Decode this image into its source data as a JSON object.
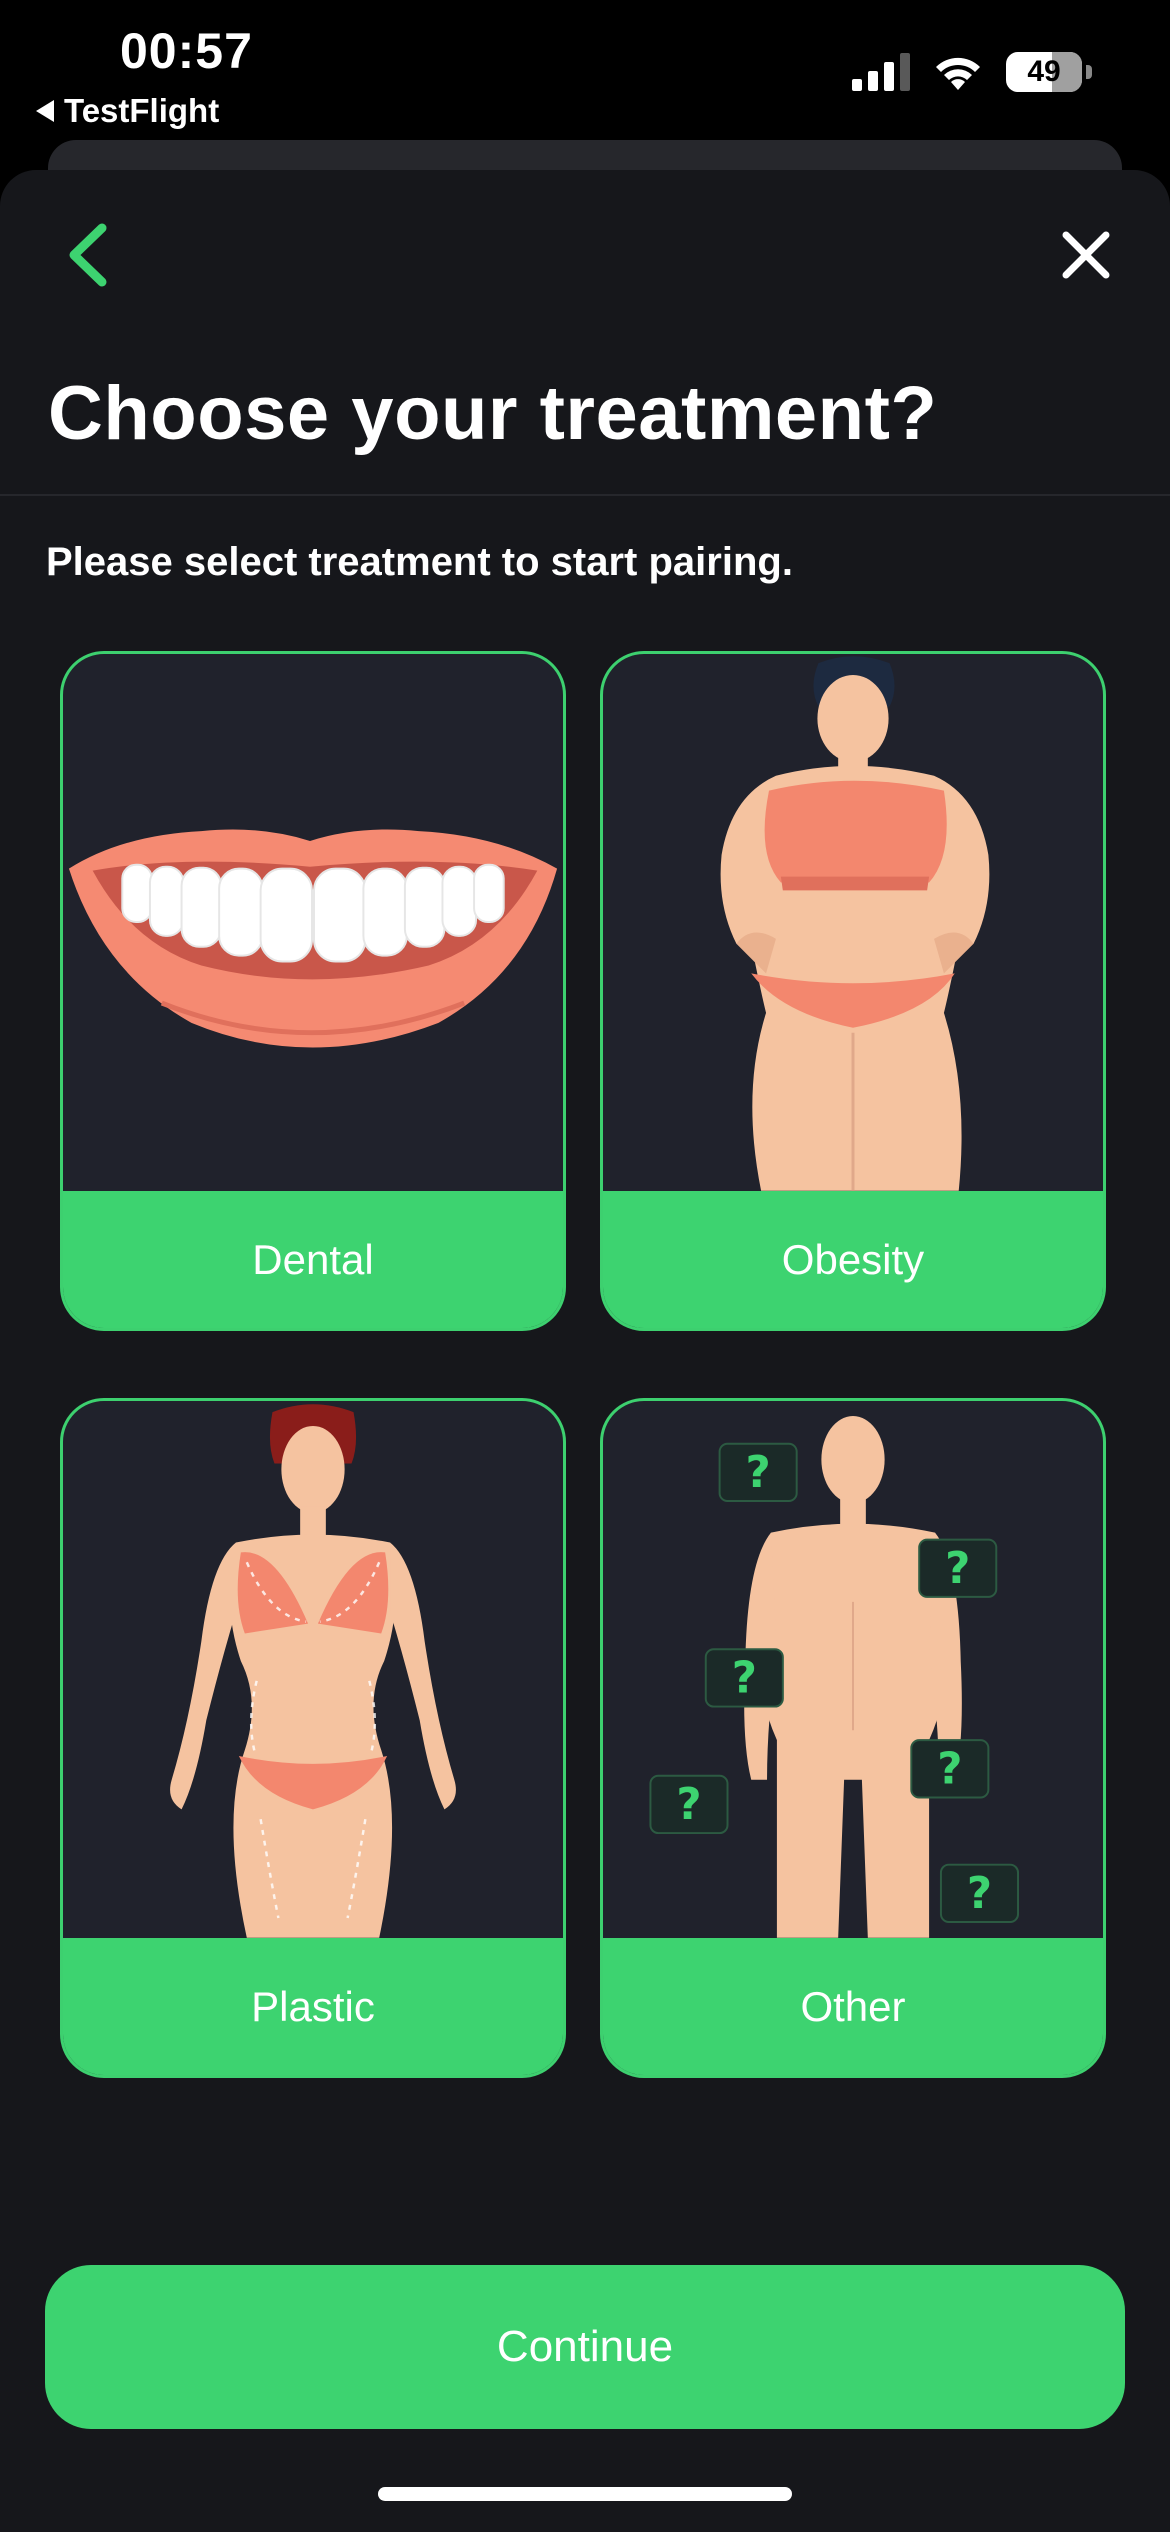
{
  "status_bar": {
    "time": "00:57",
    "back_app": "TestFlight",
    "battery": "49",
    "icons": [
      "signal-icon",
      "wifi-icon",
      "battery-icon"
    ]
  },
  "header": {
    "back_icon": "chevron-left-icon",
    "close_icon": "close-icon",
    "title": "Choose your treatment?"
  },
  "subtitle": "Please select treatment to start pairing.",
  "treatments": [
    {
      "label": "Dental",
      "image": "smiling-mouth-illustration"
    },
    {
      "label": "Obesity",
      "image": "overweight-woman-illustration"
    },
    {
      "label": "Plastic",
      "image": "woman-body-contour-illustration"
    },
    {
      "label": "Other",
      "image": "body-question-marks-illustration"
    }
  ],
  "continue_label": "Continue",
  "colors": {
    "accent": "#3dd370",
    "background": "#16171b",
    "card": "#20222c",
    "text": "#ffffff"
  }
}
